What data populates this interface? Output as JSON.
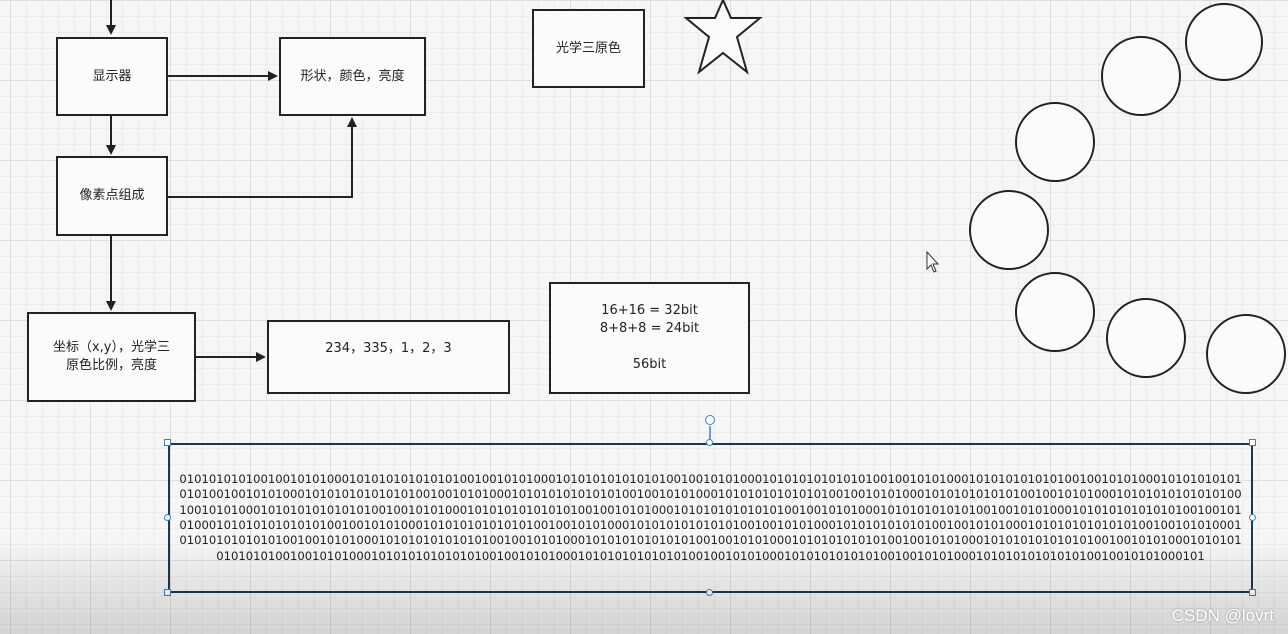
{
  "nodes": {
    "display": "显示器",
    "shape_color_brightness": "形状，颜色，亮度",
    "optics_primaries": "光学三原色",
    "pixels": "像素点组成",
    "coords_line1": "坐标（x,y），光学三",
    "coords_line2": "原色比例，亮度",
    "values": "234，335，1，2，3",
    "bits_line1": "16+16 = 32bit",
    "bits_line2": "8+8+8 = 24bit",
    "bits_total": "56bit",
    "binary": "01010101010010010101000101010101010101001001010100010101010101010100100101010001010101010101010010010101000101010101010100100101010001010101010101010010010101000101010101010101001001010100010101010101010100100101010001010101010101010010010101000101010101010100100101010001010101010101010010010101000101010101010101001001010100010101010101010100100101010001010101010101010010010101000101010101010100100101010001010101010101010010010101000101010101010101001001010100010101010101010100100101010001010101010101010010010101000101010101010100100101010001010101010101010010010101000101010101010101001001010100010101010101010100100101010001010101010101010010010101000101010101010100100101010001010101010101010010010101000101010101010101001001010100010101010101010100100101010001010101010101010010010101000101010101010100100101010001010101010101010010010101000101"
  },
  "watermark": "CSDN @lovrt",
  "colors": {
    "stroke": "#222222",
    "selection": "#3b82c4",
    "selected_border": "#1f3550"
  },
  "icons": [
    "star-shape",
    "circle-shape",
    "cursor-arrow-icon"
  ]
}
